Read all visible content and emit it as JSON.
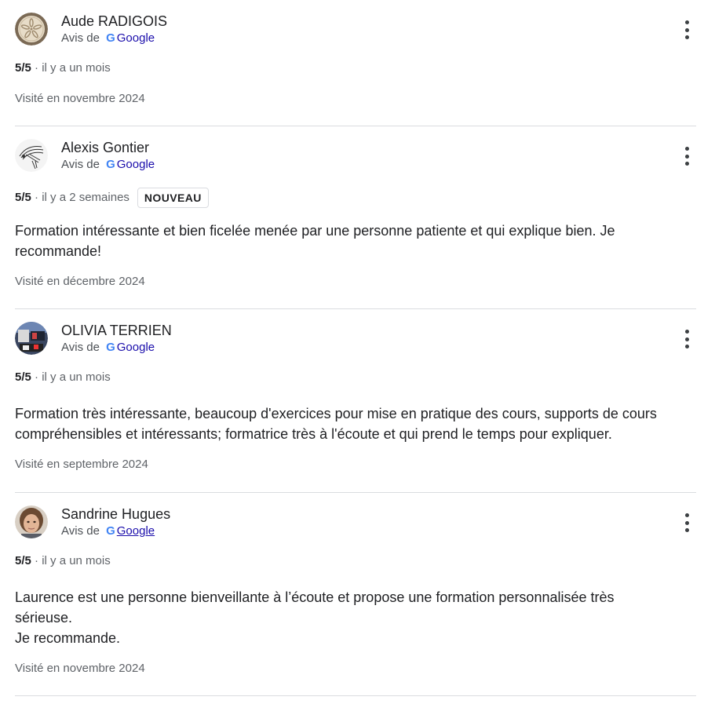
{
  "colors": {
    "google_blue": "#4285f4",
    "link": "#1a0dab",
    "divider": "#dadce0",
    "secondary_text": "#5f6368"
  },
  "reviews": [
    {
      "avatar_icon": "sand-dollar-avatar",
      "name": "Aude RADIGOIS",
      "source_prefix": "Avis de",
      "google_logo": "G",
      "source_name": "Google",
      "score": "5/5",
      "time": " · il y a un mois",
      "visited": "Visité en novembre 2024"
    },
    {
      "avatar_icon": "bird-sketch-avatar",
      "name": "Alexis Gontier",
      "source_prefix": "Avis de",
      "google_logo": "G",
      "source_name": "Google",
      "score": "5/5",
      "time": " · il y a 2 semaines",
      "badge": "NOUVEAU",
      "text": "Formation intéressante et bien ficelée menée par une personne patiente et qui explique bien. Je recommande!",
      "visited": "Visité en décembre 2024"
    },
    {
      "avatar_icon": "photo-avatar",
      "name": "OLIVIA TERRIEN",
      "source_prefix": "Avis de",
      "google_logo": "G",
      "source_name": "Google",
      "score": "5/5",
      "time": " · il y a un mois",
      "text": "Formation très intéressante, beaucoup d'exercices pour mise en pratique des cours, supports de cours compréhensibles et intéressants; formatrice très à l'écoute et qui prend le temps pour expliquer.",
      "visited": "Visité en septembre 2024"
    },
    {
      "avatar_icon": "portrait-avatar",
      "name": "Sandrine Hugues",
      "source_prefix": "Avis de",
      "google_logo": "G",
      "source_name": "Google",
      "score": "5/5",
      "time": " · il y a un mois",
      "text": "Laurence est une personne bienveillante à l’écoute et propose une formation personnalisée très\nsérieuse.\nJe recommande.",
      "visited": "Visité en novembre 2024"
    }
  ]
}
